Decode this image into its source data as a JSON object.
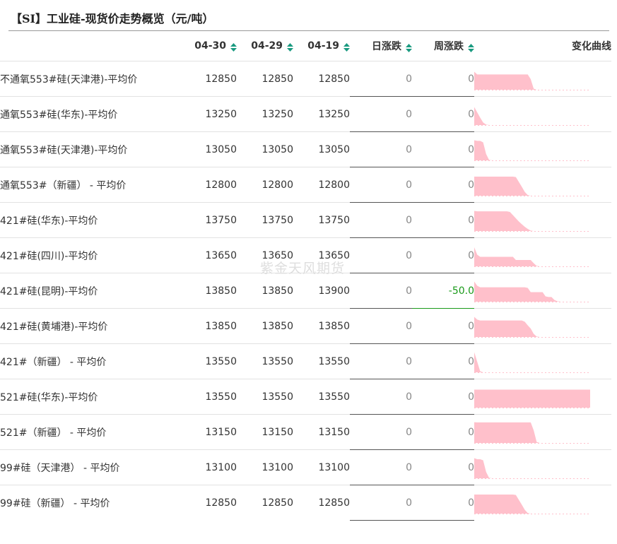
{
  "title": "【SI】工业硅-现货价走势概览（元/吨）",
  "watermark": "紫金天风期货",
  "headers": {
    "name": "",
    "d1": "04-30",
    "d2": "04-29",
    "d3": "04-19",
    "day_change": "日涨跌",
    "week_change": "周涨跌",
    "trend": "变化曲线"
  },
  "colors": {
    "spark_fill": "#ffc0cb",
    "sort_icon": "#1a9a80",
    "negative_change": "#1a9a1a",
    "neutral_change": "#888888"
  },
  "rows": [
    {
      "name": "不通氧553#硅(天津港)-平均价",
      "d1": "12850",
      "d2": "12850",
      "d3": "12850",
      "day": "0",
      "week": "0",
      "spark": [
        0.85,
        0.72,
        0.72,
        0.72,
        0.72,
        0.72,
        0.72,
        0.72,
        0.72,
        0.72,
        0.72,
        0.72,
        0.72,
        0.72,
        0.72,
        0.72,
        0.72,
        0.72,
        0.72,
        0.5,
        0.05,
        0,
        0,
        0,
        0,
        0,
        0,
        0,
        0,
        0,
        0,
        0,
        0,
        0,
        0,
        0,
        0,
        0,
        0,
        0
      ]
    },
    {
      "name": "通氧553#硅(华东)-平均价",
      "d1": "13250",
      "d2": "13250",
      "d3": "13250",
      "day": "0",
      "week": "0",
      "spark": [
        0.85,
        0.6,
        0.35,
        0.12,
        0.02,
        0,
        0,
        0,
        0,
        0,
        0,
        0,
        0,
        0,
        0,
        0,
        0,
        0,
        0,
        0,
        0,
        0,
        0,
        0,
        0,
        0,
        0,
        0,
        0,
        0,
        0,
        0,
        0,
        0,
        0,
        0,
        0,
        0,
        0,
        0
      ]
    },
    {
      "name": "通氧553#硅(天津港)-平均价",
      "d1": "13050",
      "d2": "13050",
      "d3": "13050",
      "day": "0",
      "week": "0",
      "spark": [
        0.95,
        0.92,
        0.92,
        0.85,
        0.3,
        0.02,
        0,
        0,
        0,
        0,
        0,
        0,
        0,
        0,
        0,
        0,
        0,
        0,
        0,
        0,
        0,
        0,
        0,
        0,
        0,
        0,
        0,
        0,
        0,
        0,
        0,
        0,
        0,
        0,
        0,
        0,
        0,
        0,
        0,
        0
      ]
    },
    {
      "name": "通氧553#（新疆） - 平均价",
      "d1": "12800",
      "d2": "12800",
      "d3": "12800",
      "day": "0",
      "week": "0",
      "spark": [
        0.9,
        0.9,
        0.9,
        0.9,
        0.9,
        0.9,
        0.9,
        0.9,
        0.9,
        0.9,
        0.9,
        0.9,
        0.9,
        0.9,
        0.88,
        0.65,
        0.42,
        0.18,
        0.03,
        0,
        0,
        0,
        0,
        0,
        0,
        0,
        0,
        0,
        0,
        0,
        0,
        0,
        0,
        0,
        0,
        0,
        0,
        0,
        0,
        0
      ]
    },
    {
      "name": "421#硅(华东)-平均价",
      "d1": "13750",
      "d2": "13750",
      "d3": "13750",
      "day": "0",
      "week": "0",
      "spark": [
        0.95,
        0.93,
        0.93,
        0.93,
        0.93,
        0.93,
        0.93,
        0.93,
        0.93,
        0.93,
        0.93,
        0.93,
        0.9,
        0.75,
        0.6,
        0.45,
        0.32,
        0.2,
        0.1,
        0.02,
        0,
        0,
        0,
        0,
        0,
        0,
        0,
        0,
        0,
        0,
        0,
        0,
        0,
        0,
        0,
        0,
        0,
        0,
        0,
        0
      ]
    },
    {
      "name": "421#硅(四川)-平均价",
      "d1": "13650",
      "d2": "13650",
      "d3": "13650",
      "day": "0",
      "week": "0",
      "spark": [
        0.9,
        0.55,
        0.45,
        0.45,
        0.45,
        0.45,
        0.45,
        0.45,
        0.45,
        0.45,
        0.45,
        0.45,
        0.45,
        0.45,
        0.3,
        0.3,
        0.3,
        0.3,
        0.3,
        0.3,
        0.15,
        0.02,
        0,
        0,
        0,
        0,
        0,
        0,
        0,
        0,
        0,
        0,
        0,
        0,
        0,
        0,
        0,
        0,
        0,
        0
      ]
    },
    {
      "name": "421#硅(昆明)-平均价",
      "d1": "13850",
      "d2": "13850",
      "d3": "13900",
      "day": "0",
      "week": "-50.0",
      "spark": [
        0.95,
        0.75,
        0.68,
        0.68,
        0.68,
        0.68,
        0.68,
        0.68,
        0.68,
        0.68,
        0.68,
        0.68,
        0.68,
        0.68,
        0.68,
        0.68,
        0.68,
        0.68,
        0.65,
        0.45,
        0.45,
        0.45,
        0.45,
        0.45,
        0.25,
        0.22,
        0.22,
        0.08,
        0.02,
        0,
        0,
        0,
        0,
        0,
        0,
        0,
        0,
        0,
        0,
        0
      ]
    },
    {
      "name": "421#硅(黄埔港)-平均价",
      "d1": "13850",
      "d2": "13850",
      "d3": "13850",
      "day": "0",
      "week": "0",
      "spark": [
        0.95,
        0.82,
        0.78,
        0.78,
        0.78,
        0.78,
        0.78,
        0.78,
        0.78,
        0.78,
        0.78,
        0.78,
        0.78,
        0.78,
        0.78,
        0.78,
        0.78,
        0.72,
        0.55,
        0.4,
        0.15,
        0.02,
        0,
        0,
        0,
        0,
        0,
        0,
        0,
        0,
        0,
        0,
        0,
        0,
        0,
        0,
        0,
        0,
        0,
        0
      ]
    },
    {
      "name": "421#（新疆） - 平均价",
      "d1": "13550",
      "d2": "13550",
      "d3": "13550",
      "day": "0",
      "week": "0",
      "spark": [
        0.95,
        0.5,
        0.05,
        0,
        0,
        0,
        0,
        0,
        0,
        0,
        0,
        0,
        0,
        0,
        0,
        0,
        0,
        0,
        0,
        0,
        0,
        0,
        0,
        0,
        0,
        0,
        0,
        0,
        0,
        0,
        0,
        0,
        0,
        0,
        0,
        0,
        0,
        0,
        0,
        0
      ]
    },
    {
      "name": "521#硅(华东)-平均价",
      "d1": "13550",
      "d2": "13550",
      "d3": "13550",
      "day": "0",
      "week": "0",
      "spark": [
        0.85,
        0.85,
        0.85,
        0.85,
        0.85,
        0.85,
        0.85,
        0.85,
        0.85,
        0.85,
        0.85,
        0.85,
        0.85,
        0.85,
        0.85,
        0.85,
        0.85,
        0.85,
        0.85,
        0.85,
        0.85,
        0.85,
        0.85,
        0.85,
        0.85,
        0.85,
        0.85,
        0.85,
        0.85,
        0.85,
        0.85,
        0.85,
        0.85,
        0.85,
        0.85,
        0.85,
        0.85,
        0.85,
        0.85,
        0.85
      ]
    },
    {
      "name": "521#（新疆） - 平均价",
      "d1": "13150",
      "d2": "13150",
      "d3": "13150",
      "day": "0",
      "week": "0",
      "spark": [
        0.98,
        0.97,
        0.97,
        0.97,
        0.97,
        0.97,
        0.97,
        0.97,
        0.97,
        0.97,
        0.97,
        0.97,
        0.97,
        0.97,
        0.97,
        0.97,
        0.97,
        0.97,
        0.97,
        0.97,
        0.6,
        0.05,
        0,
        0,
        0,
        0,
        0,
        0,
        0,
        0,
        0,
        0,
        0,
        0,
        0,
        0,
        0,
        0,
        0,
        0
      ]
    },
    {
      "name": "99#硅（天津港） - 平均价",
      "d1": "13100",
      "d2": "13100",
      "d3": "13100",
      "day": "0",
      "week": "0",
      "spark": [
        0.95,
        0.9,
        0.9,
        0.85,
        0.3,
        0.02,
        0,
        0,
        0,
        0,
        0,
        0,
        0,
        0,
        0,
        0,
        0,
        0,
        0,
        0,
        0,
        0,
        0,
        0,
        0,
        0,
        0,
        0,
        0,
        0,
        0,
        0,
        0,
        0,
        0,
        0,
        0,
        0,
        0,
        0
      ]
    },
    {
      "name": "99#硅（新疆） - 平均价",
      "d1": "12850",
      "d2": "12850",
      "d3": "12850",
      "day": "0",
      "week": "0",
      "spark": [
        0.9,
        0.9,
        0.9,
        0.9,
        0.9,
        0.9,
        0.9,
        0.9,
        0.9,
        0.9,
        0.9,
        0.9,
        0.9,
        0.9,
        0.88,
        0.65,
        0.42,
        0.18,
        0.03,
        0,
        0,
        0,
        0,
        0,
        0,
        0,
        0,
        0,
        0,
        0,
        0,
        0,
        0,
        0,
        0,
        0,
        0,
        0,
        0,
        0
      ]
    }
  ]
}
